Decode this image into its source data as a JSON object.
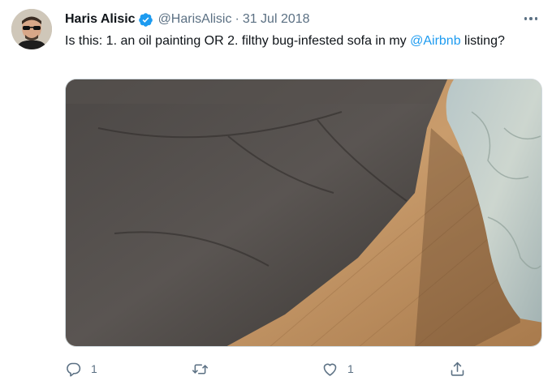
{
  "tweet": {
    "author_name": "Haris Alisic",
    "handle": "@HarisAlisic",
    "separator": "·",
    "date": "31 Jul 2018",
    "text_before": "Is this: 1. an oil painting OR 2. filthy bug-infested sofa in my ",
    "mention": "@Airbnb",
    "text_after": " listing?"
  },
  "actions": {
    "reply_count": "1",
    "like_count": "1"
  },
  "icons": {
    "verified": "verified-badge-icon",
    "more": "more-options-icon",
    "reply": "reply-icon",
    "retweet": "retweet-icon",
    "like": "heart-icon",
    "share": "share-icon"
  },
  "colors": {
    "accent": "#1d9bf0",
    "muted": "#5b7083",
    "text": "#0f1419"
  }
}
